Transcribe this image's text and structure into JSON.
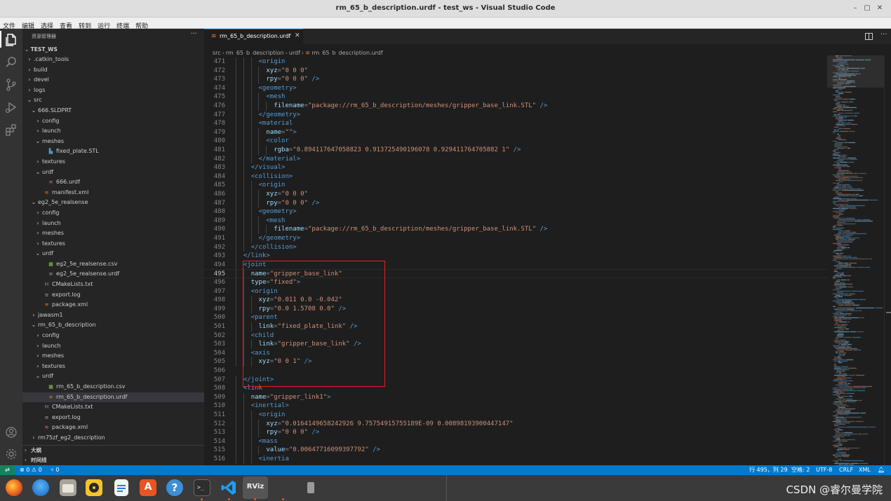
{
  "window": {
    "title": "rm_65_b_description.urdf - test_ws - Visual Studio Code",
    "controls": [
      "–",
      "▢",
      "✕"
    ]
  },
  "menu": [
    "文件",
    "编辑",
    "选择",
    "查看",
    "转到",
    "运行",
    "终端",
    "帮助"
  ],
  "sidebar": {
    "header": "资源管理器",
    "more": "···",
    "root": "TEST_WS",
    "items": [
      {
        "label": ".catkin_tools",
        "depth": 1,
        "chev": "›",
        "kind": "folder"
      },
      {
        "label": "build",
        "depth": 1,
        "chev": "›",
        "kind": "folder"
      },
      {
        "label": "devel",
        "depth": 1,
        "chev": "›",
        "kind": "folder"
      },
      {
        "label": "logs",
        "depth": 1,
        "chev": "›",
        "kind": "folder"
      },
      {
        "label": "src",
        "depth": 1,
        "chev": "⌄",
        "kind": "folder"
      },
      {
        "label": "666.SLDPRT",
        "depth": 2,
        "chev": "⌄",
        "kind": "folder"
      },
      {
        "label": "config",
        "depth": 3,
        "chev": "›",
        "kind": "folder"
      },
      {
        "label": "launch",
        "depth": 3,
        "chev": "›",
        "kind": "folder"
      },
      {
        "label": "meshes",
        "depth": 3,
        "chev": "⌄",
        "kind": "folder"
      },
      {
        "label": "fixed_plate.STL",
        "depth": 4,
        "kind": "stl"
      },
      {
        "label": "textures",
        "depth": 3,
        "chev": "›",
        "kind": "folder"
      },
      {
        "label": "urdf",
        "depth": 3,
        "chev": "⌄",
        "kind": "folder"
      },
      {
        "label": "666.urdf",
        "depth": 4,
        "kind": "rss"
      },
      {
        "label": "manifest.xml",
        "depth": 3,
        "kind": "rss"
      },
      {
        "label": "eg2_5e_realsense",
        "depth": 2,
        "chev": "⌄",
        "kind": "folder"
      },
      {
        "label": "config",
        "depth": 3,
        "chev": "›",
        "kind": "folder"
      },
      {
        "label": "launch",
        "depth": 3,
        "chev": "›",
        "kind": "folder"
      },
      {
        "label": "meshes",
        "depth": 3,
        "chev": "›",
        "kind": "folder"
      },
      {
        "label": "textures",
        "depth": 3,
        "chev": "›",
        "kind": "folder"
      },
      {
        "label": "urdf",
        "depth": 3,
        "chev": "⌄",
        "kind": "folder"
      },
      {
        "label": "eg2_5e_realsense.csv",
        "depth": 4,
        "kind": "csv"
      },
      {
        "label": "eg2_5e_realsense.urdf",
        "depth": 4,
        "kind": "lines"
      },
      {
        "label": "CMakeLists.txt",
        "depth": 3,
        "kind": "cmake"
      },
      {
        "label": "export.log",
        "depth": 3,
        "kind": "lines"
      },
      {
        "label": "package.xml",
        "depth": 3,
        "kind": "rss"
      },
      {
        "label": "jawasm1",
        "depth": 2,
        "chev": "›",
        "kind": "folder"
      },
      {
        "label": "rm_65_b_description",
        "depth": 2,
        "chev": "⌄",
        "kind": "folder"
      },
      {
        "label": "config",
        "depth": 3,
        "chev": "›",
        "kind": "folder"
      },
      {
        "label": "launch",
        "depth": 3,
        "chev": "›",
        "kind": "folder"
      },
      {
        "label": "meshes",
        "depth": 3,
        "chev": "›",
        "kind": "folder"
      },
      {
        "label": "textures",
        "depth": 3,
        "chev": "›",
        "kind": "folder"
      },
      {
        "label": "urdf",
        "depth": 3,
        "chev": "⌄",
        "kind": "folder"
      },
      {
        "label": "rm_65_b_description.csv",
        "depth": 4,
        "kind": "csv"
      },
      {
        "label": "rm_65_b_description.urdf",
        "depth": 4,
        "kind": "rss",
        "selected": true
      },
      {
        "label": "CMakeLists.txt",
        "depth": 3,
        "kind": "cmake"
      },
      {
        "label": "export.log",
        "depth": 3,
        "kind": "lines"
      },
      {
        "label": "package.xml",
        "depth": 3,
        "kind": "rss"
      },
      {
        "label": "rm75zf_eg2_description",
        "depth": 2,
        "chev": "›",
        "kind": "folder"
      }
    ],
    "outline_label": "大纲",
    "timeline_label": "时间线"
  },
  "tab": {
    "label": "rm_65_b_description.urdf",
    "close": "✕"
  },
  "breadcrumb": [
    "src",
    "rm_65_b_description",
    "urdf",
    "rm_65_b_description.urdf"
  ],
  "editor": {
    "current_line": 495,
    "lines": [
      {
        "n": 471,
        "i": 3,
        "t": [
          [
            "tg",
            "<origin"
          ]
        ]
      },
      {
        "n": 472,
        "i": 4,
        "t": [
          [
            "at",
            "xyz"
          ],
          [
            "pu",
            "="
          ],
          [
            "st",
            "\"0 0 0\""
          ]
        ]
      },
      {
        "n": 473,
        "i": 4,
        "t": [
          [
            "at",
            "rpy"
          ],
          [
            "pu",
            "="
          ],
          [
            "st",
            "\"0 0 0\""
          ],
          [
            "tg",
            " />"
          ]
        ]
      },
      {
        "n": 474,
        "i": 3,
        "t": [
          [
            "tg",
            "<geometry>"
          ]
        ]
      },
      {
        "n": 475,
        "i": 4,
        "t": [
          [
            "tg",
            "<mesh"
          ]
        ]
      },
      {
        "n": 476,
        "i": 5,
        "t": [
          [
            "at",
            "filename"
          ],
          [
            "pu",
            "="
          ],
          [
            "st",
            "\"package://rm_65_b_description/meshes/gripper_base_link.STL\""
          ],
          [
            "tg",
            " />"
          ]
        ]
      },
      {
        "n": 477,
        "i": 3,
        "t": [
          [
            "tg",
            "</geometry>"
          ]
        ]
      },
      {
        "n": 478,
        "i": 3,
        "t": [
          [
            "tg",
            "<material"
          ]
        ]
      },
      {
        "n": 479,
        "i": 4,
        "t": [
          [
            "at",
            "name"
          ],
          [
            "pu",
            "="
          ],
          [
            "st",
            "\"\""
          ],
          [
            "tg",
            ">"
          ]
        ]
      },
      {
        "n": 480,
        "i": 4,
        "t": [
          [
            "tg",
            "<color"
          ]
        ]
      },
      {
        "n": 481,
        "i": 5,
        "t": [
          [
            "at",
            "rgba"
          ],
          [
            "pu",
            "="
          ],
          [
            "st",
            "\"0.894117647058823 0.913725490196078 0.929411764705882 1\""
          ],
          [
            "tg",
            " />"
          ]
        ]
      },
      {
        "n": 482,
        "i": 3,
        "t": [
          [
            "tg",
            "</material>"
          ]
        ]
      },
      {
        "n": 483,
        "i": 2,
        "t": [
          [
            "tg",
            "</visual>"
          ]
        ]
      },
      {
        "n": 484,
        "i": 2,
        "t": [
          [
            "tg",
            "<collision>"
          ]
        ]
      },
      {
        "n": 485,
        "i": 3,
        "t": [
          [
            "tg",
            "<origin"
          ]
        ]
      },
      {
        "n": 486,
        "i": 4,
        "t": [
          [
            "at",
            "xyz"
          ],
          [
            "pu",
            "="
          ],
          [
            "st",
            "\"0 0 0\""
          ]
        ]
      },
      {
        "n": 487,
        "i": 4,
        "t": [
          [
            "at",
            "rpy"
          ],
          [
            "pu",
            "="
          ],
          [
            "st",
            "\"0 0 0\""
          ],
          [
            "tg",
            " />"
          ]
        ]
      },
      {
        "n": 488,
        "i": 3,
        "t": [
          [
            "tg",
            "<geometry>"
          ]
        ]
      },
      {
        "n": 489,
        "i": 4,
        "t": [
          [
            "tg",
            "<mesh"
          ]
        ]
      },
      {
        "n": 490,
        "i": 5,
        "t": [
          [
            "at",
            "filename"
          ],
          [
            "pu",
            "="
          ],
          [
            "st",
            "\"package://rm_65_b_description/meshes/gripper_base_link.STL\""
          ],
          [
            "tg",
            " />"
          ]
        ]
      },
      {
        "n": 491,
        "i": 3,
        "t": [
          [
            "tg",
            "</geometry>"
          ]
        ]
      },
      {
        "n": 492,
        "i": 2,
        "t": [
          [
            "tg",
            "</collision>"
          ]
        ]
      },
      {
        "n": 493,
        "i": 1,
        "t": [
          [
            "tg",
            "</link>"
          ]
        ]
      },
      {
        "n": 494,
        "i": 1,
        "t": [
          [
            "tg",
            "<joint"
          ]
        ]
      },
      {
        "n": 495,
        "i": 2,
        "t": [
          [
            "at",
            "name"
          ],
          [
            "pu",
            "="
          ],
          [
            "st",
            "\"gripper_base_link\""
          ]
        ]
      },
      {
        "n": 496,
        "i": 2,
        "t": [
          [
            "at",
            "type"
          ],
          [
            "pu",
            "="
          ],
          [
            "st",
            "\"fixed\""
          ],
          [
            "tg",
            ">"
          ]
        ]
      },
      {
        "n": 497,
        "i": 2,
        "t": [
          [
            "tg",
            "<origin"
          ]
        ]
      },
      {
        "n": 498,
        "i": 3,
        "t": [
          [
            "at",
            "xyz"
          ],
          [
            "pu",
            "="
          ],
          [
            "st",
            "\"0.011 0.0 -0.042\""
          ]
        ]
      },
      {
        "n": 499,
        "i": 3,
        "t": [
          [
            "at",
            "rpy"
          ],
          [
            "pu",
            "="
          ],
          [
            "st",
            "\"0.0 1.5708 0.0\""
          ],
          [
            "tg",
            " />"
          ]
        ]
      },
      {
        "n": 500,
        "i": 2,
        "t": [
          [
            "tg",
            "<parent"
          ]
        ]
      },
      {
        "n": 501,
        "i": 3,
        "t": [
          [
            "at",
            "link"
          ],
          [
            "pu",
            "="
          ],
          [
            "st",
            "\"fixed_plate_link\""
          ],
          [
            "tg",
            " />"
          ]
        ]
      },
      {
        "n": 502,
        "i": 2,
        "t": [
          [
            "tg",
            "<child"
          ]
        ]
      },
      {
        "n": 503,
        "i": 3,
        "t": [
          [
            "at",
            "link"
          ],
          [
            "pu",
            "="
          ],
          [
            "st",
            "\"gripper_base_link\""
          ],
          [
            "tg",
            " />"
          ]
        ]
      },
      {
        "n": 504,
        "i": 2,
        "t": [
          [
            "tg",
            "<axis"
          ]
        ]
      },
      {
        "n": 505,
        "i": 3,
        "t": [
          [
            "at",
            "xyz"
          ],
          [
            "pu",
            "="
          ],
          [
            "st",
            "\"0 0 1\""
          ],
          [
            "tg",
            " />"
          ]
        ]
      },
      {
        "n": 506,
        "i": 0,
        "t": []
      },
      {
        "n": 507,
        "i": 1,
        "t": [
          [
            "tg",
            "</joint>"
          ]
        ]
      },
      {
        "n": 508,
        "i": 1,
        "t": [
          [
            "tg",
            "<link"
          ]
        ]
      },
      {
        "n": 509,
        "i": 2,
        "t": [
          [
            "at",
            "name"
          ],
          [
            "pu",
            "="
          ],
          [
            "st",
            "\"gripper_link1\""
          ],
          [
            "tg",
            ">"
          ]
        ]
      },
      {
        "n": 510,
        "i": 2,
        "t": [
          [
            "tg",
            "<inertial>"
          ]
        ]
      },
      {
        "n": 511,
        "i": 3,
        "t": [
          [
            "tg",
            "<origin"
          ]
        ]
      },
      {
        "n": 512,
        "i": 4,
        "t": [
          [
            "at",
            "xyz"
          ],
          [
            "pu",
            "="
          ],
          [
            "st",
            "\"0.0164149658242926 9.75754915755189E-09 0.00898193900447147\""
          ]
        ]
      },
      {
        "n": 513,
        "i": 4,
        "t": [
          [
            "at",
            "rpy"
          ],
          [
            "pu",
            "="
          ],
          [
            "st",
            "\"0 0 0\""
          ],
          [
            "tg",
            " />"
          ]
        ]
      },
      {
        "n": 514,
        "i": 3,
        "t": [
          [
            "tg",
            "<mass"
          ]
        ]
      },
      {
        "n": 515,
        "i": 4,
        "t": [
          [
            "at",
            "value"
          ],
          [
            "pu",
            "="
          ],
          [
            "st",
            "\"0.00647716099397792\""
          ],
          [
            "tg",
            " />"
          ]
        ]
      },
      {
        "n": 516,
        "i": 3,
        "t": [
          [
            "tg",
            "<inertia"
          ]
        ]
      }
    ]
  },
  "statusbar": {
    "remote": "⇄",
    "errors": "⊗ 0 ⚠ 0",
    "ports": "⑂ 0",
    "position": "行 495，列 29",
    "spaces": "空格: 2",
    "encoding": "UTF-8",
    "eol": "CRLF",
    "language": "XML"
  },
  "taskbar": {
    "apps": [
      "firefox-icon",
      "thunderbird-icon",
      "files-icon",
      "rhythmbox-icon",
      "writer-icon",
      "appcenter-icon",
      "help-icon",
      "terminal-icon",
      "vscode-icon",
      "rviz-icon",
      "usb-drive-icon"
    ],
    "rviz_label": "RViz",
    "watermark": "CSDN @睿尔曼学院"
  },
  "colors": {
    "accent": "#007acc",
    "selection_box": "#e0202a",
    "tag": "#569cd6",
    "attr": "#9cdcfe",
    "string": "#ce9178"
  }
}
